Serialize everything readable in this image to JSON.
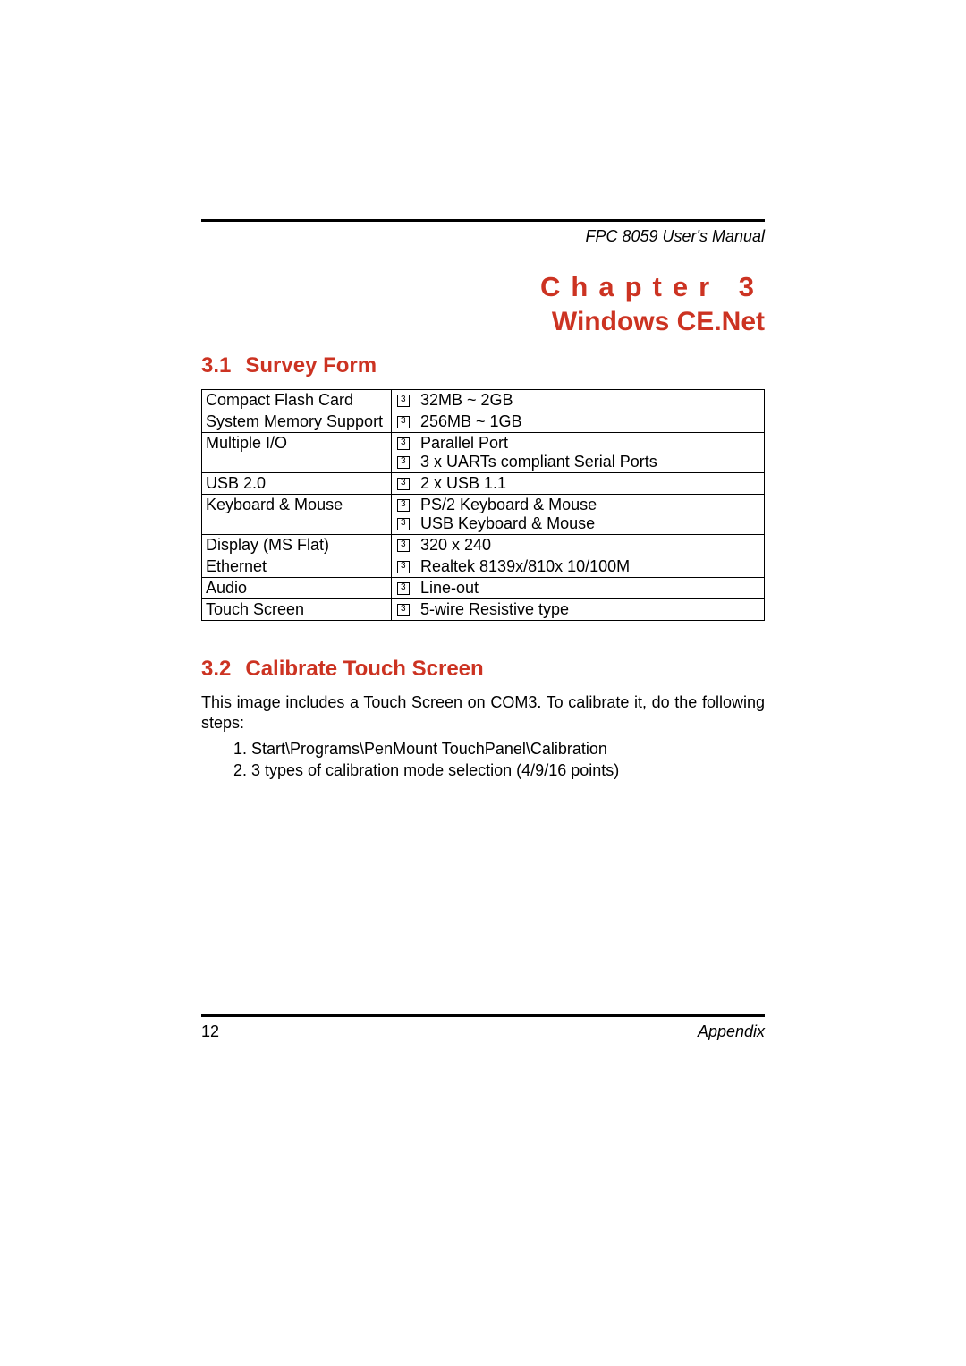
{
  "header": {
    "manual_title": "FPC 8059  User's Manual"
  },
  "chapter": {
    "label": "Chapter 3",
    "title": "Windows  CE.Net"
  },
  "sections": {
    "survey": {
      "number": "3.1",
      "title": "Survey Form",
      "rows": [
        {
          "label": "Compact Flash Card",
          "items": [
            "32MB ~ 2GB"
          ]
        },
        {
          "label": "System Memory Support",
          "items": [
            "256MB ~ 1GB"
          ]
        },
        {
          "label": "Multiple I/O",
          "items": [
            "Parallel Port",
            "3 x UARTs compliant Serial Ports"
          ]
        },
        {
          "label": "USB 2.0",
          "items": [
            "2 x USB 1.1"
          ]
        },
        {
          "label": "Keyboard & Mouse",
          "items": [
            "PS/2 Keyboard & Mouse",
            "USB Keyboard & Mouse"
          ]
        },
        {
          "label": "Display (MS Flat)",
          "items": [
            "320 x 240"
          ]
        },
        {
          "label": "Ethernet",
          "items": [
            "Realtek 8139x/810x    10/100M"
          ]
        },
        {
          "label": "Audio",
          "items": [
            "Line-out"
          ]
        },
        {
          "label": "Touch Screen",
          "items": [
            "5-wire Resistive type"
          ]
        }
      ]
    },
    "calibrate": {
      "number": "3.2",
      "title": "Calibrate Touch Screen",
      "intro": "This image includes a Touch Screen on COM3. To calibrate it, do the following steps:",
      "steps": [
        "1. Start\\Programs\\PenMount TouchPanel\\Calibration",
        "2. 3 types of calibration mode selection (4/9/16 points)"
      ]
    }
  },
  "footer": {
    "page_number": "12",
    "section": "Appendix"
  }
}
